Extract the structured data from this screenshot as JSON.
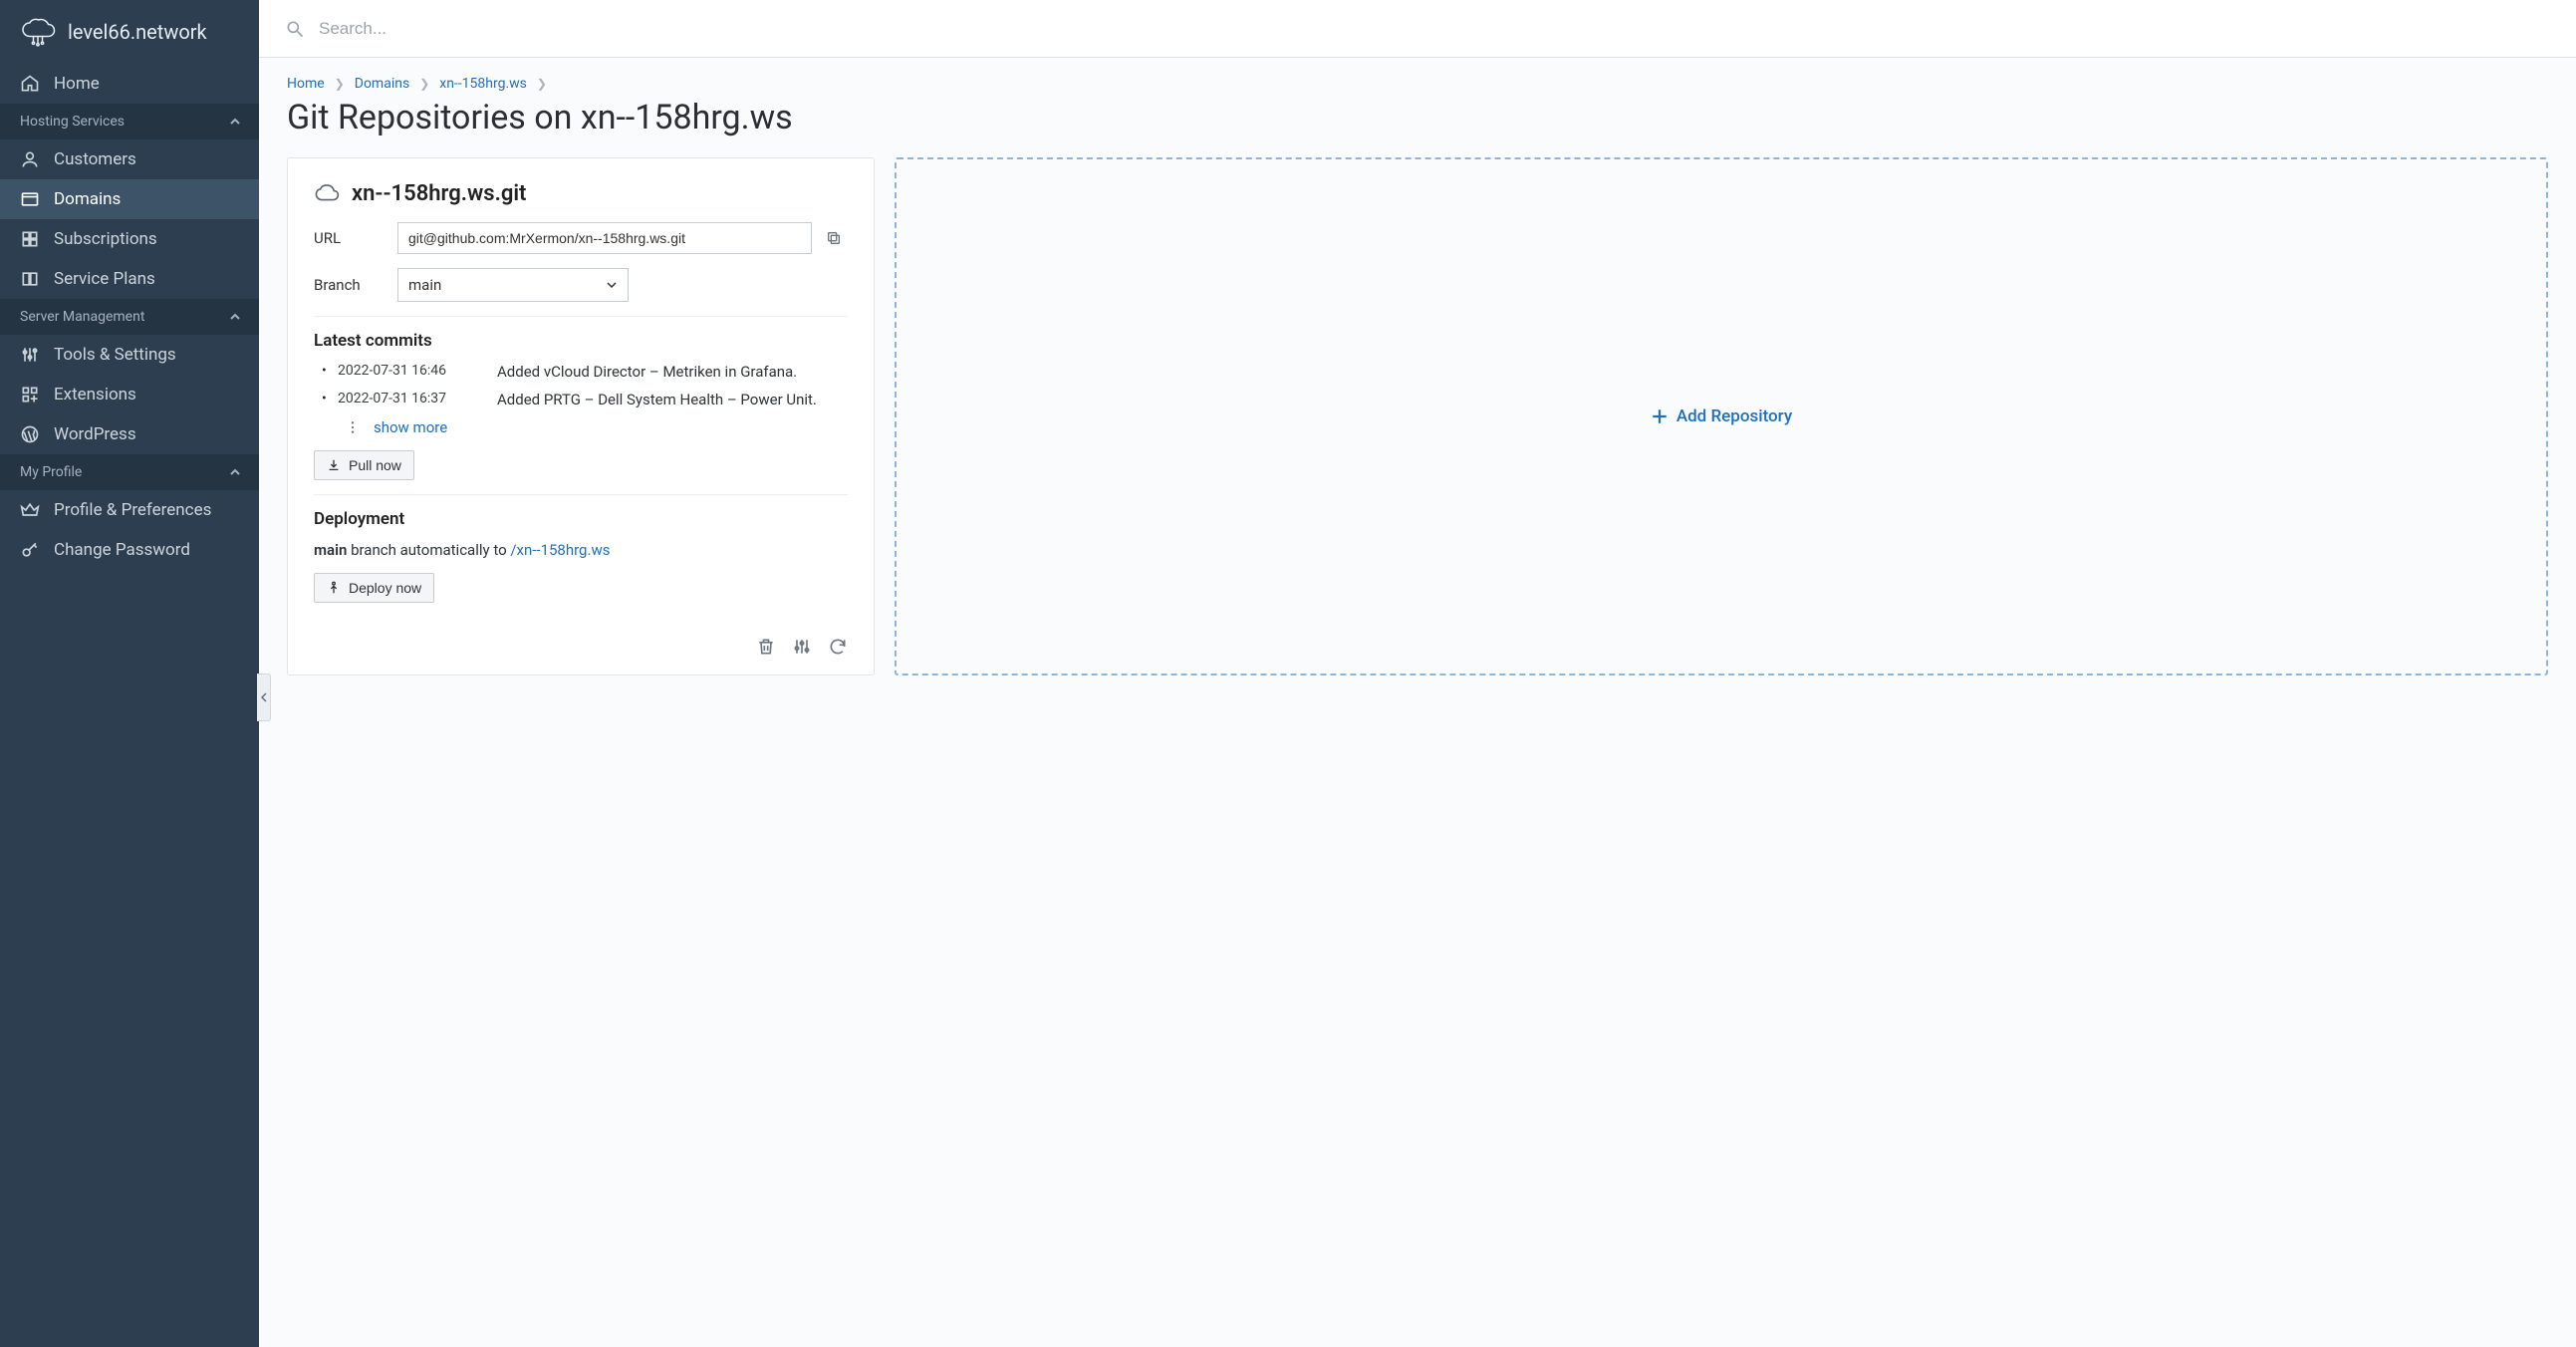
{
  "brand": "level66.network",
  "search_placeholder": "Search...",
  "breadcrumb": {
    "home": "Home",
    "domains": "Domains",
    "domain": "xn--158hrg.ws"
  },
  "page_title": "Git Repositories on xn--158hrg.ws",
  "sidebar": {
    "home": "Home",
    "section_hosting": "Hosting Services",
    "customers": "Customers",
    "domains": "Domains",
    "subscriptions": "Subscriptions",
    "service_plans": "Service Plans",
    "section_server": "Server Management",
    "tools": "Tools & Settings",
    "extensions": "Extensions",
    "wordpress": "WordPress",
    "section_profile": "My Profile",
    "profile_prefs": "Profile & Preferences",
    "change_password": "Change Password"
  },
  "repo": {
    "name": "xn--158hrg.ws.git",
    "url_label": "URL",
    "url_value": "git@github.com:MrXermon/xn--158hrg.ws.git",
    "branch_label": "Branch",
    "branch_value": "main",
    "commits_heading": "Latest commits",
    "commits": [
      {
        "date": "2022-07-31 16:46",
        "msg": "Added vCloud Director – Metriken in Grafana."
      },
      {
        "date": "2022-07-31 16:37",
        "msg": "Added PRTG – Dell System Health – Power Unit."
      }
    ],
    "show_more": "show more",
    "pull_now": "Pull now",
    "deploy_heading": "Deployment",
    "deploy_branch": "main",
    "deploy_text_mid": " branch automatically to ",
    "deploy_path": "/xn--158hrg.ws",
    "deploy_now": "Deploy now"
  },
  "add_repo_label": "Add Repository"
}
